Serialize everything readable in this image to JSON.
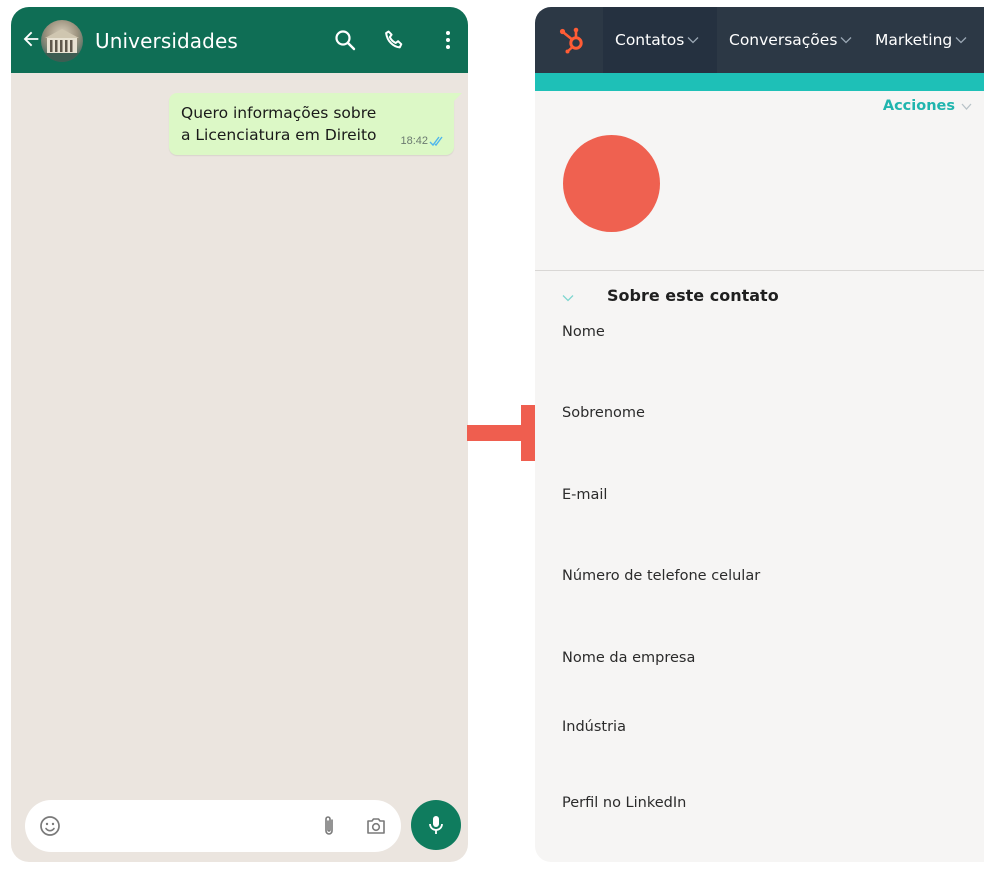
{
  "whatsapp": {
    "contact_name": "Universidades",
    "message": {
      "text": "Quero informações sobre\na Licenciatura em Direito",
      "time": "18:42",
      "status": "read-double-check"
    },
    "colors": {
      "header": "#0f6e55",
      "bubble": "#dcf8c6",
      "background": "#ebe5df",
      "mic_button": "#0f7c5e"
    },
    "icons": [
      "back-arrow-icon",
      "search-icon",
      "phone-icon",
      "more-vert-icon",
      "emoji-icon",
      "attach-icon",
      "camera-icon",
      "mic-icon"
    ]
  },
  "hubspot": {
    "nav": {
      "tabs": [
        {
          "label": "Contatos",
          "active": true
        },
        {
          "label": "Conversações",
          "active": false
        },
        {
          "label": "Marketing",
          "active": false
        }
      ]
    },
    "actions_label": "Acciones",
    "section_title": "Sobre este contato",
    "fields": [
      "Nome",
      "Sobrenome",
      "E-mail",
      "Número de telefone celular",
      "Nome da empresa",
      "Indústria",
      "Perfil no LinkedIn"
    ],
    "colors": {
      "nav": "#2c3845",
      "accent_bar": "#1ec0b7",
      "avatar": "#ef6150",
      "logo": "#ff5c35",
      "connector": "#ef5e4f"
    }
  }
}
